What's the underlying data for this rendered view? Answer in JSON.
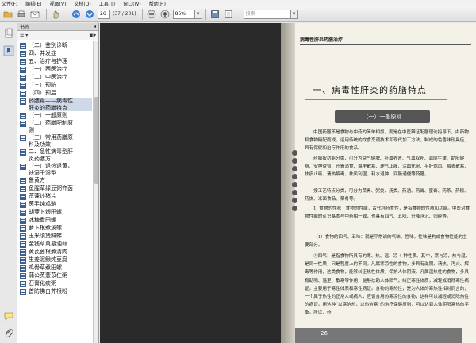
{
  "menu": [
    "文件(F)",
    "编辑(E)",
    "视图(V)",
    "文档(D)",
    "工具(T)",
    "窗口(W)",
    "帮助(H)"
  ],
  "toolbar": {
    "page_current": "26",
    "page_total": "(37 / 201)",
    "zoom": "86%",
    "search_placeholder": "搜索"
  },
  "panel": {
    "title": "书签",
    "options": "☰ ▾"
  },
  "bookmarks": [
    "（二）鉴别诊断",
    "四、并发症",
    "五、治疗与护理",
    "（一）西医治疗",
    "（二）中医治疗",
    "（三）预防",
    "（四）预后",
    "药膳篇——病毒性\n肝炎的药膳特点",
    "（一）一般原则",
    "（二）药膳配制原\n则",
    "（三）常用药膳原\n料及功效",
    "二、急性病毒型肝\n炎药膳方",
    "（一）退热退黄，\n祛湿于湿型",
    "鲁黄方",
    "鱼腥草绿豆粥齐茵",
    "荒蓬炒猪片",
    "茵手炖鸡骆",
    "胡萝卜煨田螺",
    "冰糖煮田螺",
    "萝卜根煮溪螺",
    "玉米须煲鲜蚌",
    "金钱草萬墓油蒜",
    "黄芪茵根煮清肉",
    "生姜泥鳅炖豆腐",
    "鸡骨草煮田螺",
    "蒲公英薏苡仁粥",
    "石膏化痰粥",
    "首防佛白芥根粉"
  ],
  "page": {
    "header": "病毒性肝炎药膳治疗",
    "chapter_title": "一、病毒性肝炎的药膳特点",
    "section": "（一）一般原则",
    "para1": "中国药膳不是食物与中药的简单相加，而是在中医辨证配膳理论指导下，由药物和食物精配而成，运用传统的饮食烹调技术和现代加工方法，制成的色香味形具佳、具有保健和治疗作用的食品。",
    "para2": "药膳按功能分类，可分为益气健脾、补血养肾、气血双补、滋阴生津、助阳健身、安神益智、开胃消食、温里散寒、理气止痛、活血化瘀、平肝熄风、解表散寒、祛痰止咳、清热解毒、祛风利湿、利水退肿、润肠通便等药膳。",
    "para3": "按工艺特点分类，可分为菜肴、粥类、汤类、药酒、药膏、蜜膏、药茶、药糕、药饼、米面食品、菜肴等。",
    "para4": "1. 食物的性味　食物的性能，古代称药食性，是指食物的性质和功能。中医对食物性能的认识基本与中药相一致，也具有四气、五味、升降浮沉、归经等。",
    "para5": "（1）食物的四气、五味：就是平常说的气味、性味。性味是构成食物性能的主要部分。",
    "para6": "①四气：是指食物所具有的寒、热、温、凉 4 种性质。其中，寒与凉，热与温，是同一性质，只是程度上的不同。凡属寒凉性的食物，多具有滋阴、清热、泻火、解毒等作用，这类食物，能够纠正热性体质，保护人体阴液。凡属温热性的食物，多具有助阳、温里、散寒等作用，能够扶助人体阳气，纠正寒性体质，减轻或消除寒性病证。主要用于寒性体质和寒性病证。食物的寒热性，是为人体的寒热性相对而言的，一个属于热性的正常人或病人，应该食用热寒凉性的食物，这样可以减轻或消除热性的病证。用这种“以寒治热，以热治寒”的治疗保健原则，可以达到人体阴阳寒热的平衡。所以，药",
    "page_number": "26"
  }
}
